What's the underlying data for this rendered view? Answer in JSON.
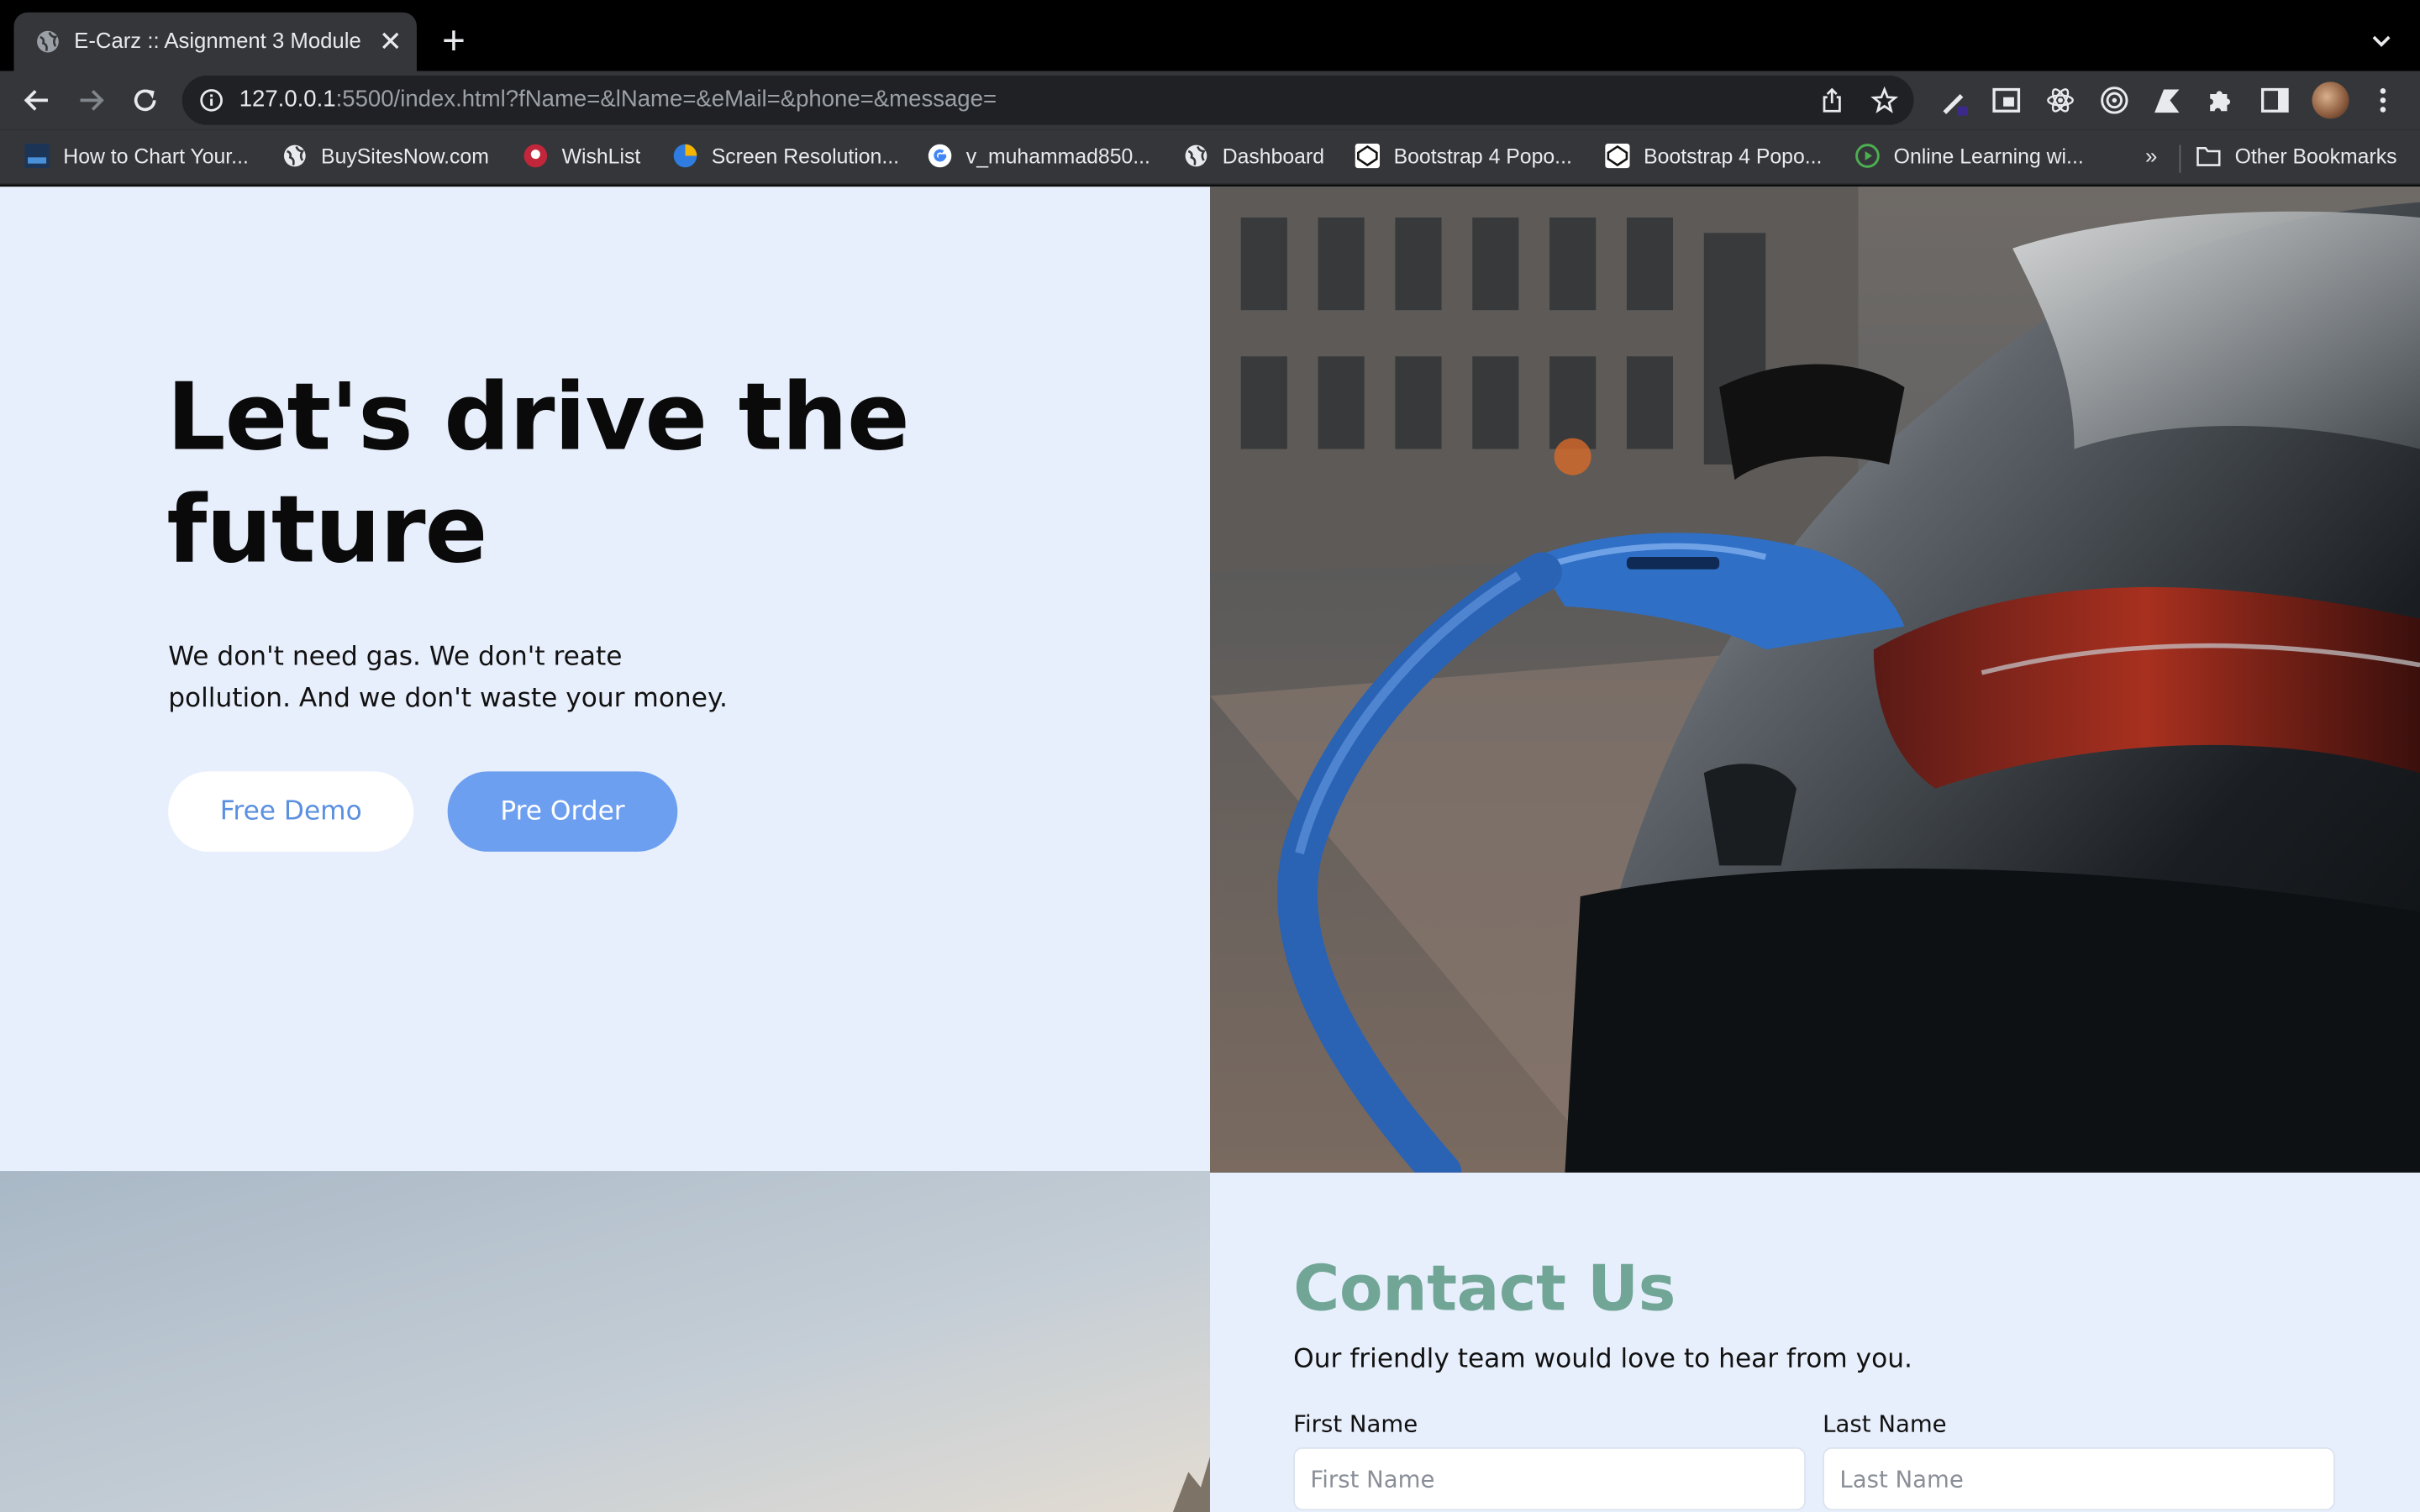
{
  "browser": {
    "tab_title": "E-Carz :: Asignment 3 Module",
    "url_host": "127.0.0.1",
    "url_rest": ":5500/index.html?fName=&lName=&eMail=&phone=&message=",
    "bookmarks": [
      {
        "label": "How to Chart Your...",
        "icon": "webstudio-icon"
      },
      {
        "label": "BuySitesNow.com",
        "icon": "globe-icon"
      },
      {
        "label": "WishList",
        "icon": "wishlist-icon"
      },
      {
        "label": "Screen Resolution...",
        "icon": "screen-resolution-icon"
      },
      {
        "label": "v_muhammad850...",
        "icon": "google-icon"
      },
      {
        "label": "Dashboard",
        "icon": "globe-icon"
      },
      {
        "label": "Bootstrap 4 Popo...",
        "icon": "codepen-icon"
      },
      {
        "label": "Bootstrap 4 Popo...",
        "icon": "codepen-icon"
      },
      {
        "label": "Online Learning wi...",
        "icon": "play-icon"
      }
    ],
    "more_bookmarks": "»",
    "other_bookmarks": "Other Bookmarks"
  },
  "hero": {
    "title": "Let's drive the future",
    "subtitle": "We don't need gas. We don't reate pollution. And we don't waste your money.",
    "demo_button": "Free Demo",
    "order_button": "Pre Order"
  },
  "contact": {
    "title": "Contact Us",
    "subtitle": "Our friendly team would love to hear from you.",
    "first_name_label": "First Name",
    "first_name_placeholder": "First Name",
    "last_name_label": "Last Name",
    "last_name_placeholder": "Last Name"
  },
  "colors": {
    "page_bg": "#e8effc",
    "primary_button": "#6d9ff0",
    "contact_title": "#71a697"
  }
}
